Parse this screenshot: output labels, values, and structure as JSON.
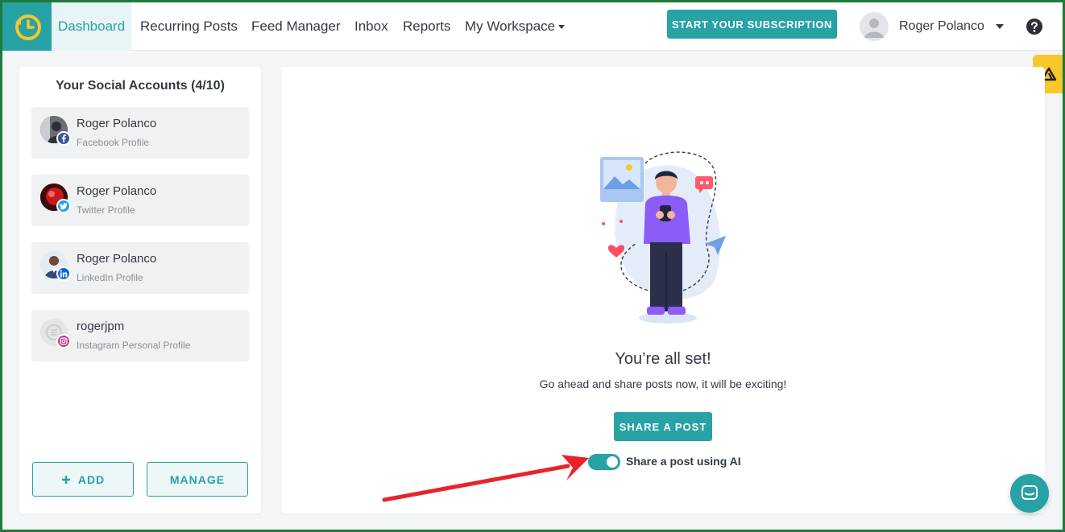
{
  "nav": {
    "items": [
      "Dashboard",
      "Recurring Posts",
      "Feed Manager",
      "Inbox",
      "Reports",
      "My Workspace"
    ],
    "cta": "START YOUR SUBSCRIPTION",
    "user": "Roger Polanco"
  },
  "sidebar": {
    "title": "Your Social Accounts (4/10)",
    "accounts": [
      {
        "name": "Roger Polanco",
        "type": "Facebook Profile",
        "network_color": "#3b5998"
      },
      {
        "name": "Roger Polanco",
        "type": "Twitter Profile",
        "network_color": "#1da1f2"
      },
      {
        "name": "Roger Polanco",
        "type": "LinkedIn Profile",
        "network_color": "#0a66c2"
      },
      {
        "name": "rogerjpm",
        "type": "Instagram Personal Profile",
        "network_color": "#c13584"
      }
    ],
    "add_label": "ADD",
    "manage_label": "MANAGE"
  },
  "main": {
    "title": "You’re all set!",
    "subtitle": "Go ahead and share posts now, it will be exciting!",
    "share_button": "SHARE A POST",
    "ai_toggle_label": "Share a post using AI",
    "ai_toggle_on": true
  },
  "colors": {
    "accent": "#27a2a5",
    "side_tab": "#f7c72c",
    "frame": "#1e7a3a"
  }
}
